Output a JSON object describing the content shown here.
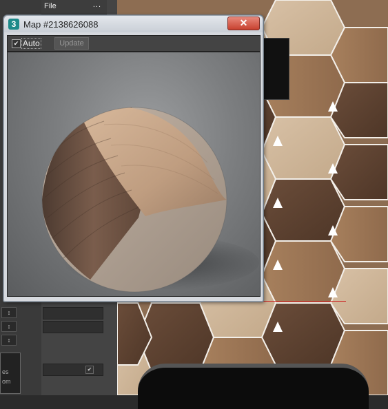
{
  "host": {
    "file_menu": "File",
    "file_menu_more": "...",
    "left_panel_text": [
      "es",
      "om"
    ],
    "spinners": [
      "↕",
      "↕",
      "↕"
    ]
  },
  "window": {
    "title": "Map #2138626088",
    "icon_glyph": "3",
    "close_glyph": "✕"
  },
  "toolbar": {
    "auto_checked": true,
    "auto_check_glyph": "✔",
    "auto_label": "Auto",
    "update_label": "Update"
  },
  "preview": {
    "subject": "wood-material-sphere"
  },
  "colors": {
    "close_red": "#c7412f",
    "title_bar": "#d6d9de"
  }
}
